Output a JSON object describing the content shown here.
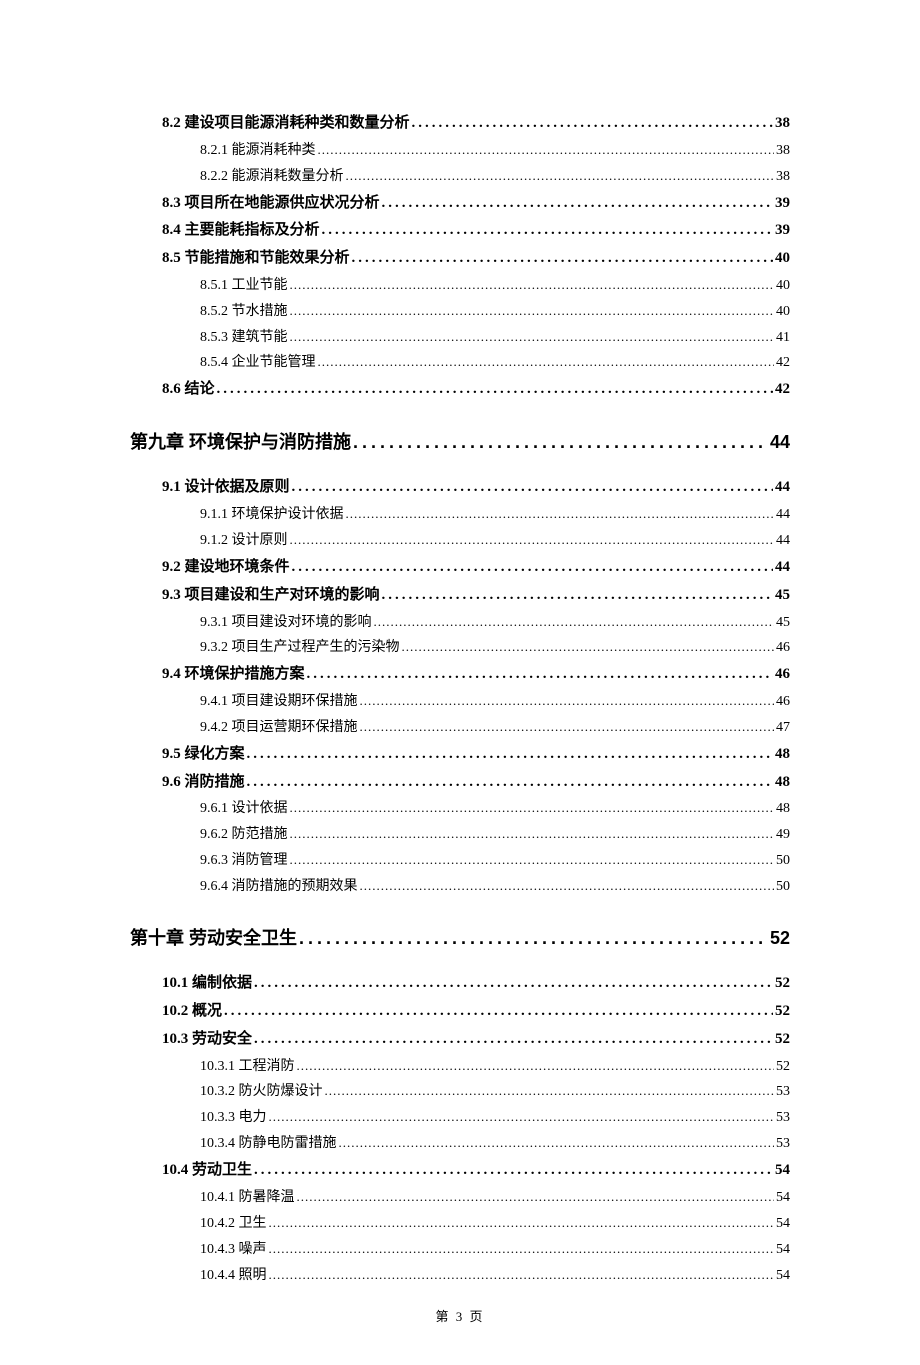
{
  "toc": [
    {
      "level": 2,
      "num": "8.2",
      "title": "建设项目能源消耗种类和数量分析",
      "page": "38"
    },
    {
      "level": 3,
      "num": "8.2.1",
      "title": "能源消耗种类",
      "page": "38"
    },
    {
      "level": 3,
      "num": "8.2.2",
      "title": "能源消耗数量分析",
      "page": "38"
    },
    {
      "level": 2,
      "num": "8.3",
      "title": "项目所在地能源供应状况分析",
      "page": "39"
    },
    {
      "level": 2,
      "num": "8.4",
      "title": "主要能耗指标及分析",
      "page": "39"
    },
    {
      "level": 2,
      "num": "8.5",
      "title": "节能措施和节能效果分析",
      "page": "40"
    },
    {
      "level": 3,
      "num": "8.5.1",
      "title": "工业节能",
      "page": "40"
    },
    {
      "level": 3,
      "num": "8.5.2",
      "title": "节水措施",
      "page": "40"
    },
    {
      "level": 3,
      "num": "8.5.3",
      "title": "建筑节能",
      "page": "41"
    },
    {
      "level": 3,
      "num": "8.5.4",
      "title": "企业节能管理",
      "page": "42"
    },
    {
      "level": 2,
      "num": "8.6",
      "title": "结论",
      "page": "42"
    },
    {
      "level": 1,
      "num": "第九章",
      "title": "环境保护与消防措施",
      "page": "44"
    },
    {
      "level": 2,
      "num": "9.1",
      "title": "设计依据及原则",
      "page": "44"
    },
    {
      "level": 3,
      "num": "9.1.1",
      "title": "环境保护设计依据",
      "page": "44"
    },
    {
      "level": 3,
      "num": "9.1.2",
      "title": "设计原则",
      "page": "44"
    },
    {
      "level": 2,
      "num": "9.2",
      "title": "建设地环境条件",
      "page": "44"
    },
    {
      "level": 2,
      "num": "9.3",
      "title": " 项目建设和生产对环境的影响",
      "page": "45"
    },
    {
      "level": 3,
      "num": "9.3.1",
      "title": " 项目建设对环境的影响",
      "page": "45"
    },
    {
      "level": 3,
      "num": "9.3.2",
      "title": " 项目生产过程产生的污染物",
      "page": "46"
    },
    {
      "level": 2,
      "num": "9.4",
      "title": " 环境保护措施方案",
      "page": "46"
    },
    {
      "level": 3,
      "num": "9.4.1",
      "title": " 项目建设期环保措施",
      "page": "46"
    },
    {
      "level": 3,
      "num": "9.4.2",
      "title": " 项目运营期环保措施",
      "page": "47"
    },
    {
      "level": 2,
      "num": "9.5",
      "title": "绿化方案",
      "page": "48"
    },
    {
      "level": 2,
      "num": "9.6",
      "title": "消防措施",
      "page": "48"
    },
    {
      "level": 3,
      "num": "9.6.1",
      "title": "设计依据",
      "page": "48"
    },
    {
      "level": 3,
      "num": "9.6.2",
      "title": "防范措施",
      "page": "49"
    },
    {
      "level": 3,
      "num": "9.6.3",
      "title": "消防管理",
      "page": "50"
    },
    {
      "level": 3,
      "num": "9.6.4",
      "title": "消防措施的预期效果",
      "page": "50"
    },
    {
      "level": 1,
      "num": "第十章",
      "title": "劳动安全卫生",
      "page": "52"
    },
    {
      "level": 2,
      "num": "10.1",
      "title": " 编制依据",
      "page": "52"
    },
    {
      "level": 2,
      "num": "10.2",
      "title": "概况",
      "page": "52"
    },
    {
      "level": 2,
      "num": "10.3",
      "title": " 劳动安全",
      "page": "52"
    },
    {
      "level": 3,
      "num": "10.3.1",
      "title": "工程消防",
      "page": "52"
    },
    {
      "level": 3,
      "num": "10.3.2",
      "title": "防火防爆设计",
      "page": "53"
    },
    {
      "level": 3,
      "num": "10.3.3",
      "title": "电力",
      "page": "53"
    },
    {
      "level": 3,
      "num": "10.3.4",
      "title": "防静电防雷措施",
      "page": "53"
    },
    {
      "level": 2,
      "num": "10.4",
      "title": "劳动卫生",
      "page": "54"
    },
    {
      "level": 3,
      "num": "10.4.1",
      "title": "防暑降温",
      "page": "54"
    },
    {
      "level": 3,
      "num": "10.4.2",
      "title": "卫生",
      "page": "54"
    },
    {
      "level": 3,
      "num": "10.4.3",
      "title": "噪声",
      "page": "54"
    },
    {
      "level": 3,
      "num": "10.4.4",
      "title": "照明",
      "page": "54"
    }
  ],
  "page_footer": "第 3 页"
}
